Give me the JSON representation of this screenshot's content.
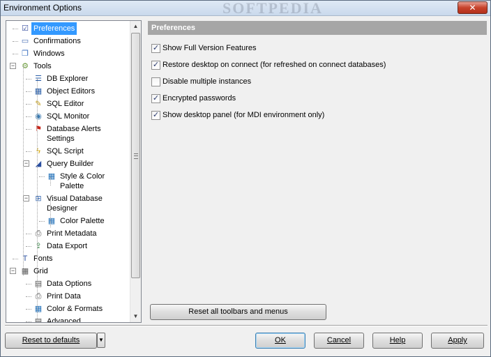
{
  "window": {
    "title": "Environment Options",
    "watermark": "SOFTPEDIA",
    "close_label": "✕"
  },
  "tree": {
    "items": [
      {
        "label": "Preferences",
        "icon": "preferences-icon",
        "glyph": "☑",
        "color": "#3a50a0",
        "selected": true
      },
      {
        "label": "Confirmations",
        "icon": "confirmations-icon",
        "glyph": "▭",
        "color": "#4a6fb5"
      },
      {
        "label": "Windows",
        "icon": "windows-icon",
        "glyph": "❐",
        "color": "#3a6fc0"
      },
      {
        "label": "Tools",
        "icon": "tools-icon",
        "glyph": "⚙",
        "color": "#6a9a3a",
        "expanded": true
      },
      {
        "label": "DB Explorer",
        "icon": "db-explorer-icon",
        "glyph": "☰",
        "color": "#2b5fa8"
      },
      {
        "label": "Object Editors",
        "icon": "object-editors-icon",
        "glyph": "▦",
        "color": "#2b5fa8"
      },
      {
        "label": "SQL Editor",
        "icon": "sql-editor-icon",
        "glyph": "✎",
        "color": "#c29a12"
      },
      {
        "label": "SQL Monitor",
        "icon": "sql-monitor-icon",
        "glyph": "◉",
        "color": "#3a7ab0"
      },
      {
        "label": "Database Alerts",
        "label2": "Settings",
        "icon": "database-alerts-icon",
        "glyph": "⚑",
        "color": "#c8261a"
      },
      {
        "label": "SQL Script",
        "icon": "sql-script-icon",
        "glyph": "ϟ",
        "color": "#d4a400"
      },
      {
        "label": "Query Builder",
        "icon": "query-builder-icon",
        "glyph": "◢",
        "color": "#2a4fa0",
        "expanded": true
      },
      {
        "label": "Style & Color",
        "label2": "Palette",
        "icon": "style-color-palette-icon",
        "glyph": "▦",
        "color": "#1f6fb8"
      },
      {
        "label": "Visual Database",
        "label2": "Designer",
        "icon": "visual-database-designer-icon",
        "glyph": "⊞",
        "color": "#3a6ab0",
        "expanded": true
      },
      {
        "label": "Color Palette",
        "icon": "color-palette-icon",
        "glyph": "▦",
        "color": "#1f6fb8"
      },
      {
        "label": "Print Metadata",
        "icon": "print-metadata-icon",
        "glyph": "⎙",
        "color": "#555"
      },
      {
        "label": "Data Export",
        "icon": "data-export-icon",
        "glyph": "⇪",
        "color": "#2a7a3a"
      },
      {
        "label": "Fonts",
        "icon": "fonts-icon",
        "glyph": "T",
        "color": "#2a4fa0"
      },
      {
        "label": "Grid",
        "icon": "grid-icon",
        "glyph": "▦",
        "color": "#555",
        "expanded": true
      },
      {
        "label": "Data Options",
        "icon": "data-options-icon",
        "glyph": "▤",
        "color": "#555"
      },
      {
        "label": "Print Data",
        "icon": "print-data-icon",
        "glyph": "⎙",
        "color": "#555"
      },
      {
        "label": "Color & Formats",
        "icon": "color-formats-icon",
        "glyph": "▦",
        "color": "#1f6fb8"
      },
      {
        "label": "Advanced",
        "icon": "advanced-icon",
        "glyph": "▤",
        "color": "#555"
      }
    ],
    "scroll_up": "▲",
    "scroll_down": "▼"
  },
  "panel": {
    "header": "Preferences",
    "options": [
      {
        "label": "Show Full Version Features",
        "checked": true
      },
      {
        "label": "Restore desktop on connect (for refreshed on connect databases)",
        "checked": true
      },
      {
        "label": "Disable multiple instances",
        "checked": false
      },
      {
        "label": "Encrypted passwords",
        "checked": true
      },
      {
        "label": "Show desktop panel (for MDI environment only)",
        "checked": true
      }
    ],
    "reset_toolbars_label": "Reset all toolbars and menus"
  },
  "footer": {
    "reset_defaults_label": "Reset to defaults",
    "dropdown_glyph": "▼",
    "ok_label": "OK",
    "cancel_label": "Cancel",
    "help_label": "Help",
    "apply_label": "Apply"
  },
  "colors": {
    "selection": "#3399ff",
    "header_bg": "#a6a6a6",
    "check": "#2a3a6e"
  }
}
